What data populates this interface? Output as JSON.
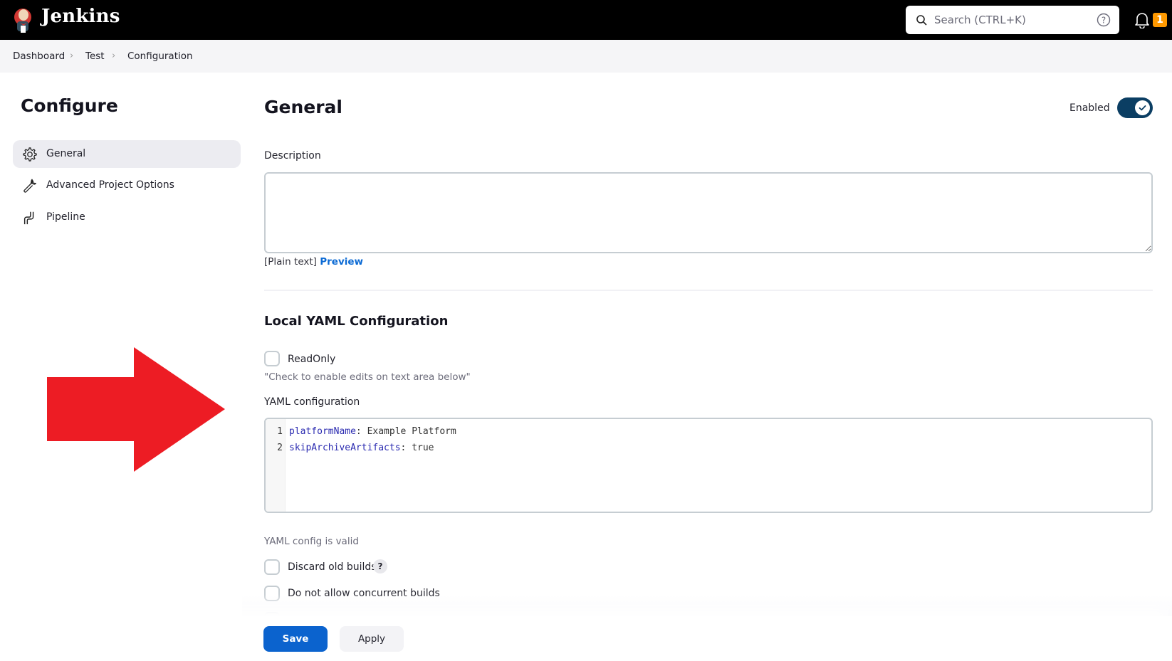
{
  "header": {
    "brand": "Jenkins",
    "search_placeholder": "Search (CTRL+K)",
    "notification_count": "1"
  },
  "breadcrumb": [
    "Dashboard",
    "Test",
    "Configuration"
  ],
  "sidebar": {
    "title": "Configure",
    "items": [
      {
        "label": "General",
        "icon": "gear-icon",
        "active": true
      },
      {
        "label": "Advanced Project Options",
        "icon": "wrench-icon",
        "active": false
      },
      {
        "label": "Pipeline",
        "icon": "pipeline-icon",
        "active": false
      }
    ]
  },
  "main": {
    "title": "General",
    "enabled_label": "Enabled",
    "enabled": true,
    "description_label": "Description",
    "description_value": "",
    "plain_text_label": "[Plain text]",
    "preview_link": "Preview",
    "yaml_section_title": "Local YAML Configuration",
    "readonly_label": "ReadOnly",
    "readonly_checked": false,
    "readonly_hint": "\"Check to enable edits on text area below\"",
    "yaml_label": "YAML configuration",
    "yaml_lines": [
      {
        "num": "1",
        "key": "platformName",
        "value": ": Example Platform"
      },
      {
        "num": "2",
        "key": "skipArchiveArtifacts",
        "value": ": true"
      }
    ],
    "yaml_status": "YAML config is valid",
    "discard_label": "Discard old builds",
    "discard_help": "?",
    "concurrent_label": "Do not allow concurrent builds"
  },
  "actions": {
    "save_label": "Save",
    "apply_label": "Apply"
  },
  "colors": {
    "annotation_arrow": "#ed1c24",
    "primary_button": "#0b63ce",
    "toggle_on": "#0b3e63",
    "badge": "#ff9900"
  }
}
